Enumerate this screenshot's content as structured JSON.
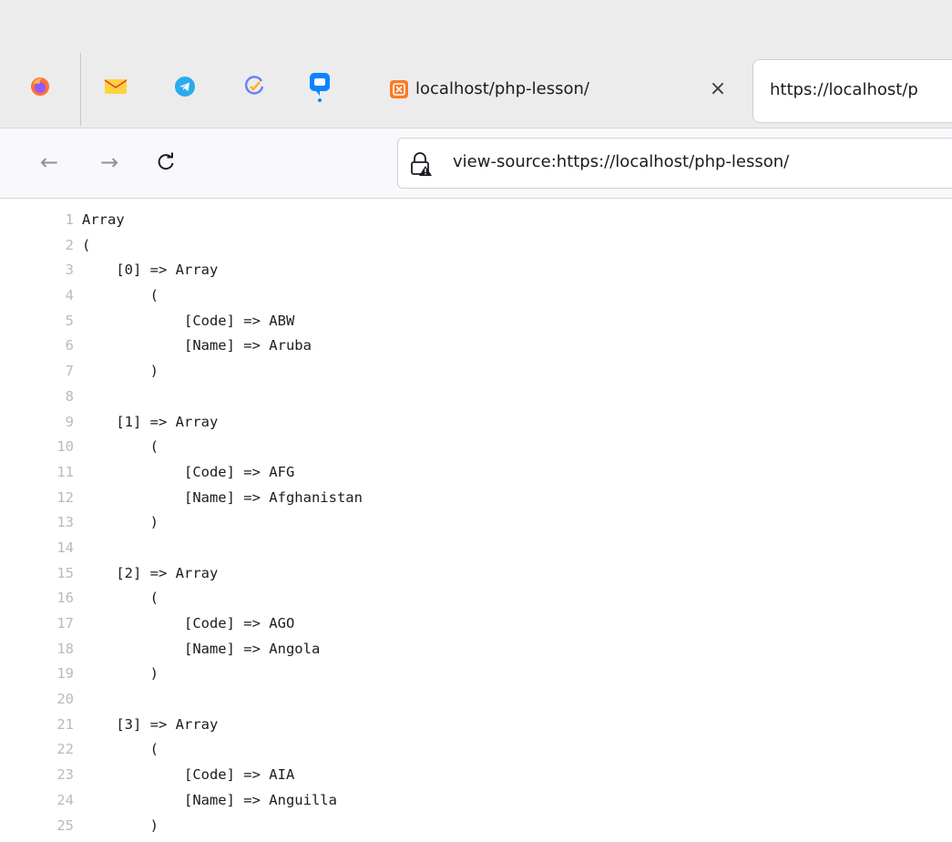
{
  "browser": {
    "pinned_tabs": [
      {
        "name": "firefox-icon"
      },
      {
        "name": "gmail-icon"
      },
      {
        "name": "telegram-icon"
      },
      {
        "name": "tasks-icon"
      },
      {
        "name": "messenger-icon"
      }
    ],
    "tabs": [
      {
        "title": "localhost/php-lesson/",
        "close": "×",
        "active": true
      },
      {
        "title": "https://localhost/p",
        "active": false
      }
    ],
    "nav": {
      "back": "←",
      "forward": "→",
      "reload": "C"
    },
    "url": "view-source:https://localhost/php-lesson/"
  },
  "source_lines": [
    {
      "n": "1",
      "text": "Array"
    },
    {
      "n": "2",
      "text": "("
    },
    {
      "n": "3",
      "text": "    [0] => Array"
    },
    {
      "n": "4",
      "text": "        ("
    },
    {
      "n": "5",
      "text": "            [Code] => ABW"
    },
    {
      "n": "6",
      "text": "            [Name] => Aruba"
    },
    {
      "n": "7",
      "text": "        )"
    },
    {
      "n": "8",
      "text": ""
    },
    {
      "n": "9",
      "text": "    [1] => Array"
    },
    {
      "n": "10",
      "text": "        ("
    },
    {
      "n": "11",
      "text": "            [Code] => AFG"
    },
    {
      "n": "12",
      "text": "            [Name] => Afghanistan"
    },
    {
      "n": "13",
      "text": "        )"
    },
    {
      "n": "14",
      "text": ""
    },
    {
      "n": "15",
      "text": "    [2] => Array"
    },
    {
      "n": "16",
      "text": "        ("
    },
    {
      "n": "17",
      "text": "            [Code] => AGO"
    },
    {
      "n": "18",
      "text": "            [Name] => Angola"
    },
    {
      "n": "19",
      "text": "        )"
    },
    {
      "n": "20",
      "text": ""
    },
    {
      "n": "21",
      "text": "    [3] => Array"
    },
    {
      "n": "22",
      "text": "        ("
    },
    {
      "n": "23",
      "text": "            [Code] => AIA"
    },
    {
      "n": "24",
      "text": "            [Name] => Anguilla"
    },
    {
      "n": "25",
      "text": "        )"
    }
  ]
}
